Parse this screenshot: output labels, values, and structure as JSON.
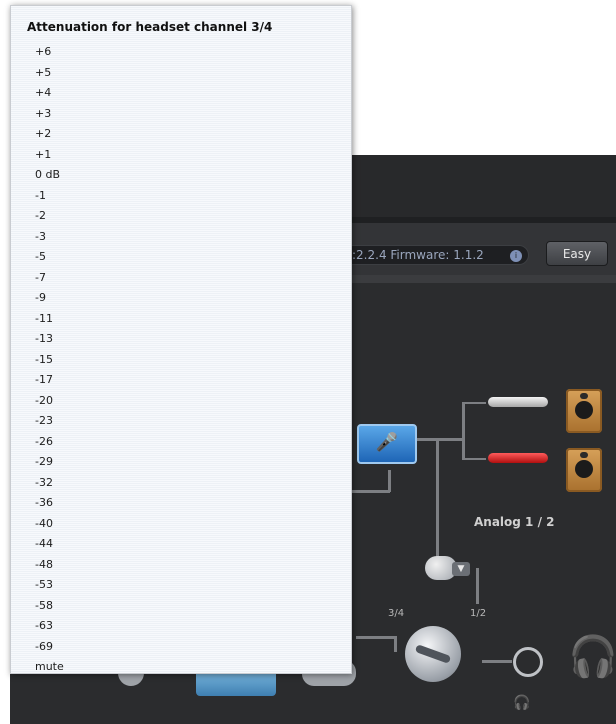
{
  "menu": {
    "title": "Attenuation for headset channel 3/4",
    "options": [
      "+6",
      "+5",
      "+4",
      "+3",
      "+2",
      "+1",
      "0 dB",
      "-1",
      "-2",
      "-3",
      "-5",
      "-7",
      "-9",
      "-11",
      "-13",
      "-15",
      "-17",
      "-20",
      "-23",
      "-26",
      "-29",
      "-32",
      "-36",
      "-40",
      "-44",
      "-48",
      "-53",
      "-58",
      "-63",
      "-69",
      "mute"
    ]
  },
  "header": {
    "firmware_text": ":2.2.4 Firmware: 1.1.2",
    "easy_button": "Easy"
  },
  "diagram": {
    "analog_label": "Analog 1 / 2",
    "channel_34_label": "3/4",
    "channel_12_label": "1/2"
  },
  "icons": {
    "mic_guitar": "microphone-guitar-icon",
    "speaker": "speaker-icon",
    "headphones": "headphones-icon",
    "knob": "volume-knob-icon"
  },
  "colors": {
    "app_background": "#2b2c2e",
    "accent_blue": "#1e65b6",
    "speaker_wood": "#c38a45",
    "jack_red": "#d32020"
  }
}
